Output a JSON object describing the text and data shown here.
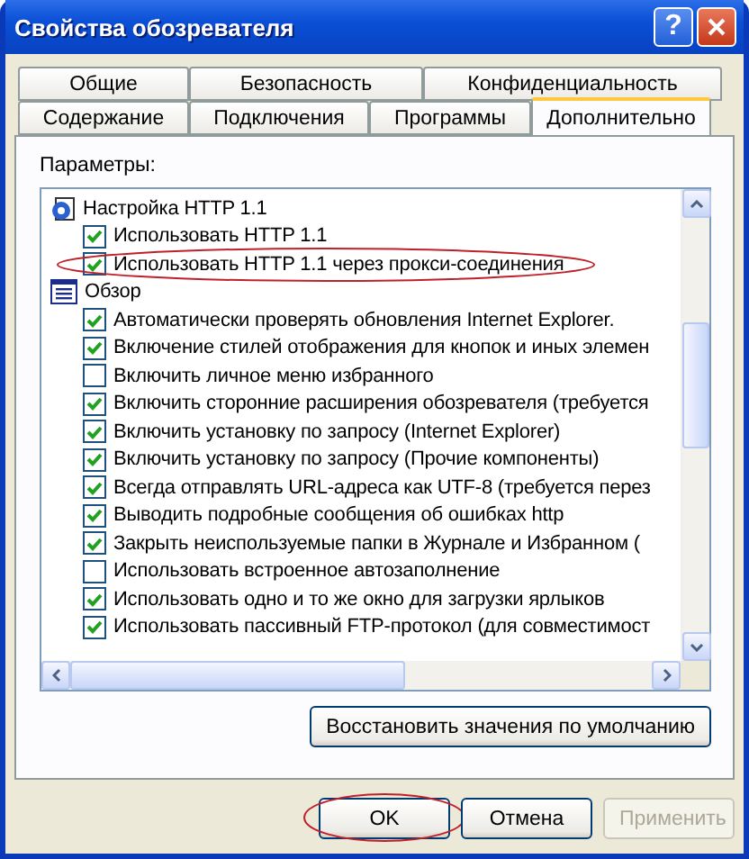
{
  "window": {
    "title": "Свойства обозревателя",
    "help": "?"
  },
  "tabs": [
    [
      {
        "label": "Общие",
        "selected": false
      },
      {
        "label": "Безопасность",
        "selected": false
      },
      {
        "label": "Конфиденциальность",
        "selected": false
      }
    ],
    [
      {
        "label": "Содержание",
        "selected": false
      },
      {
        "label": "Подключения",
        "selected": false
      },
      {
        "label": "Программы",
        "selected": false
      },
      {
        "label": "Дополнительно",
        "selected": true
      }
    ]
  ],
  "params_label": "Параметры:",
  "settings": [
    {
      "label": "Настройка HTTP 1.1",
      "children": [
        {
          "label": "Использовать HTTP 1.1",
          "checked": true,
          "circled": false
        },
        {
          "label": "Использовать HTTP 1.1 через прокси-соединения",
          "checked": true,
          "circled": true
        }
      ]
    },
    {
      "label": "Обзор",
      "children": [
        {
          "label": "Автоматически проверять обновления Internet Explorer.",
          "checked": true,
          "circled": false
        },
        {
          "label": "Включение стилей отображения для кнопок и иных элемен",
          "checked": true,
          "circled": false
        },
        {
          "label": "Включить личное меню избранного",
          "checked": false,
          "circled": false
        },
        {
          "label": "Включить сторонние расширения обозревателя (требуется",
          "checked": true,
          "circled": false
        },
        {
          "label": "Включить установку по запросу (Internet Explorer)",
          "checked": true,
          "circled": false
        },
        {
          "label": "Включить установку по запросу (Прочие компоненты)",
          "checked": true,
          "circled": false
        },
        {
          "label": "Всегда отправлять URL-адреса как UTF-8 (требуется перез",
          "checked": true,
          "circled": false
        },
        {
          "label": "Выводить подробные сообщения об ошибках http",
          "checked": true,
          "circled": false
        },
        {
          "label": "Закрыть неиспользуемые папки в Журнале и Избранном (",
          "checked": true,
          "circled": false
        },
        {
          "label": "Использовать встроенное автозаполнение",
          "checked": false,
          "circled": false
        },
        {
          "label": "Использовать одно и то же окно для загрузки ярлыков",
          "checked": true,
          "circled": false
        },
        {
          "label": "Использовать пассивный FTP-протокол (для совместимост",
          "checked": true,
          "circled": false
        }
      ]
    }
  ],
  "restore_button": "Восстановить значения по умолчанию",
  "buttons": [
    {
      "label": "OK",
      "disabled": false,
      "circled": true
    },
    {
      "label": "Отмена",
      "disabled": false,
      "circled": false
    },
    {
      "label": "Применить",
      "disabled": true,
      "circled": false
    }
  ]
}
